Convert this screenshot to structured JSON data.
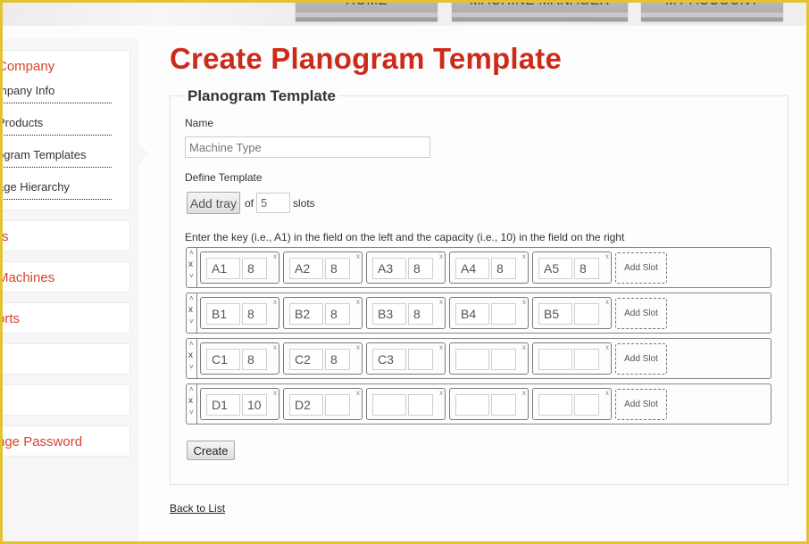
{
  "nav": {
    "tabs": [
      {
        "label": "HOME"
      },
      {
        "label": "MACHINE MANAGER"
      },
      {
        "label": "MY ACCOUNT"
      }
    ]
  },
  "sidebar": {
    "company_section": {
      "heading": "Company",
      "items": [
        {
          "label": "mpany Info"
        },
        {
          "label": "Products"
        },
        {
          "label": "ogram Templates"
        },
        {
          "label": "age Hierarchy"
        }
      ]
    },
    "sections": [
      {
        "label": "rs"
      },
      {
        "label": "Machines"
      },
      {
        "label": "orts"
      },
      {
        "label": ""
      },
      {
        "label": ""
      },
      {
        "label": "nge Password"
      }
    ]
  },
  "page": {
    "title": "Create Planogram Template",
    "legend": "Planogram Template",
    "name_label": "Name",
    "name_placeholder": "Machine Type",
    "name_value": "",
    "define_label": "Define Template",
    "add_tray_label": "Add tray",
    "of_label": "of",
    "slots_count": "5",
    "slots_label": "slots",
    "instructions": "Enter the key (i.e., A1) in the field on the left and the capacity (i.e., 10) in the field on the right",
    "add_slot_label": "Add Slot",
    "tray_controls": {
      "up": "˄",
      "remove": "x",
      "down": "˅"
    },
    "slot_remove": "x",
    "create_label": "Create",
    "back_link": "Back to List"
  },
  "trays": [
    {
      "slots": [
        {
          "key": "A1",
          "capacity": "8"
        },
        {
          "key": "A2",
          "capacity": "8"
        },
        {
          "key": "A3",
          "capacity": "8"
        },
        {
          "key": "A4",
          "capacity": "8"
        },
        {
          "key": "A5",
          "capacity": "8"
        }
      ]
    },
    {
      "slots": [
        {
          "key": "B1",
          "capacity": "8"
        },
        {
          "key": "B2",
          "capacity": "8"
        },
        {
          "key": "B3",
          "capacity": "8"
        },
        {
          "key": "B4",
          "capacity": ""
        },
        {
          "key": "B5",
          "capacity": ""
        }
      ]
    },
    {
      "slots": [
        {
          "key": "C1",
          "capacity": "8"
        },
        {
          "key": "C2",
          "capacity": "8"
        },
        {
          "key": "C3",
          "capacity": ""
        },
        {
          "key": "",
          "capacity": ""
        },
        {
          "key": "",
          "capacity": ""
        }
      ]
    },
    {
      "slots": [
        {
          "key": "D1",
          "capacity": "10"
        },
        {
          "key": "D2",
          "capacity": ""
        },
        {
          "key": "",
          "capacity": ""
        },
        {
          "key": "",
          "capacity": ""
        },
        {
          "key": "",
          "capacity": ""
        }
      ]
    }
  ],
  "colors": {
    "accent_red": "#cc2b1a",
    "sidebar_red": "#d8432f",
    "frame_yellow": "#e2c431"
  }
}
